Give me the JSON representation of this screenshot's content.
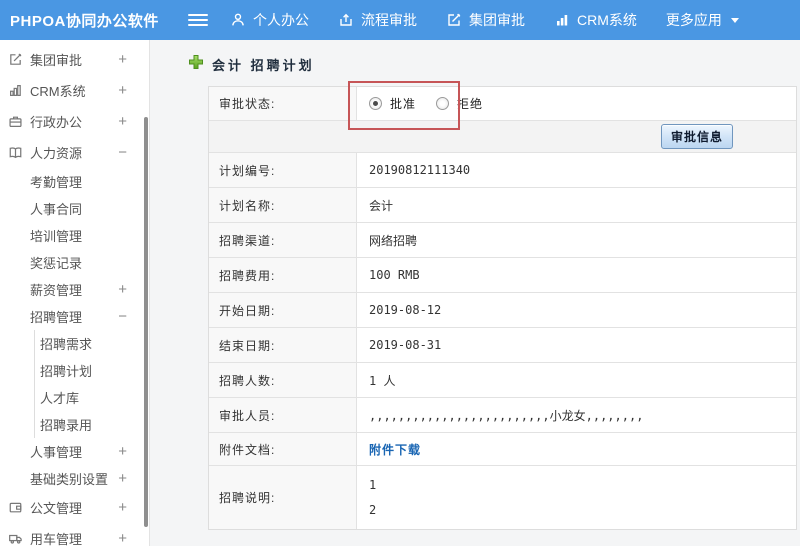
{
  "topbar": {
    "brand": "PHPOA协同办公软件",
    "nav": [
      {
        "label": "个人办公",
        "icon": "person-icon"
      },
      {
        "label": "流程审批",
        "icon": "workflow-icon"
      },
      {
        "label": "集团审批",
        "icon": "edit-icon"
      },
      {
        "label": "CRM系统",
        "icon": "bar-chart-icon"
      },
      {
        "label": "更多应用",
        "icon": "caret-down-icon"
      }
    ]
  },
  "sidebar": {
    "items": [
      {
        "label": "集团审批",
        "icon": "edit-icon",
        "expand": "+"
      },
      {
        "label": "CRM系统",
        "icon": "bar-chart-icon",
        "expand": "+"
      },
      {
        "label": "行政办公",
        "icon": "briefcase-icon",
        "expand": "+"
      },
      {
        "label": "人力资源",
        "icon": "book-icon",
        "expand": "−"
      },
      {
        "label": "考勤管理"
      },
      {
        "label": "人事合同"
      },
      {
        "label": "培训管理"
      },
      {
        "label": "奖惩记录"
      },
      {
        "label": "薪资管理",
        "expand": "+"
      },
      {
        "label": "招聘管理",
        "expand": "−"
      },
      {
        "label": "招聘需求"
      },
      {
        "label": "招聘计划"
      },
      {
        "label": "人才库"
      },
      {
        "label": "招聘录用"
      },
      {
        "label": "人事管理",
        "expand": "+"
      },
      {
        "label": "基础类别设置",
        "expand": "+"
      },
      {
        "label": "公文管理",
        "icon": "document-icon",
        "expand": "+"
      },
      {
        "label": "用车管理",
        "icon": "truck-icon",
        "expand": "+"
      }
    ]
  },
  "page": {
    "title": "会计 招聘计划"
  },
  "form": {
    "status": {
      "label": "审批状态:",
      "approve": "批准",
      "reject": "拒绝",
      "selected": "批准"
    },
    "approve_button": "审批信息",
    "rows": [
      {
        "label": "计划编号:",
        "value": "20190812111340"
      },
      {
        "label": "计划名称:",
        "value": "会计"
      },
      {
        "label": "招聘渠道:",
        "value": "网络招聘"
      },
      {
        "label": "招聘费用:",
        "value": "100 RMB"
      },
      {
        "label": "开始日期:",
        "value": "2019-08-12"
      },
      {
        "label": "结束日期:",
        "value": "2019-08-31"
      },
      {
        "label": "招聘人数:",
        "value": "1 人"
      },
      {
        "label": "审批人员:",
        "value": ",,,,,,,,,,,,,,,,,,,,,,,,,小龙女,,,,,,,,"
      }
    ],
    "attachment": {
      "label": "附件文档:",
      "link": "附件下载"
    },
    "description": {
      "label": "招聘说明:",
      "lines": [
        "1",
        "2"
      ]
    }
  },
  "colors": {
    "topbar_blue": "#4a97e3",
    "accent_green": "#6cc234",
    "annotation_red": "#c65557",
    "link_blue": "#1a66b3",
    "button_border_blue": "#7096be"
  }
}
